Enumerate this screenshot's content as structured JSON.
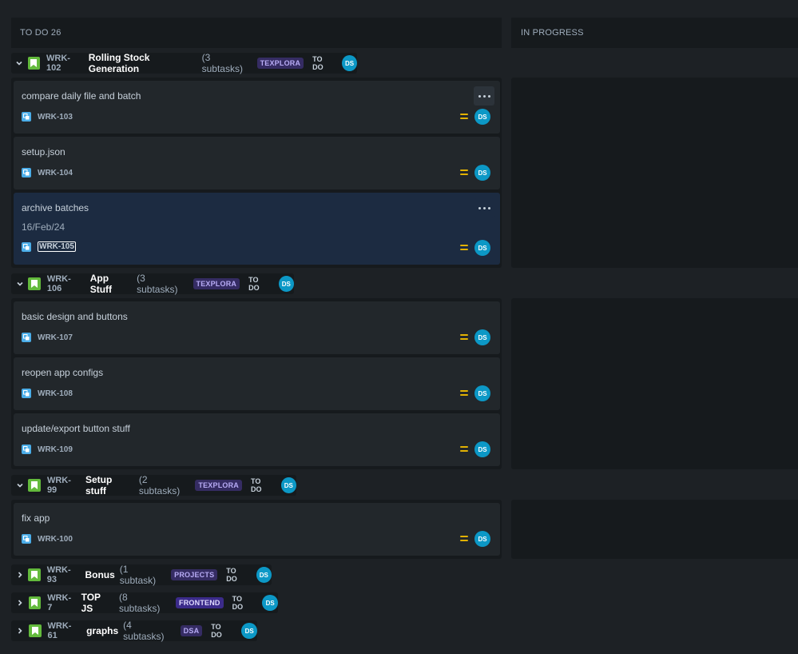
{
  "columns": [
    {
      "title": "TO DO 26"
    },
    {
      "title": "IN PROGRESS"
    }
  ],
  "colors": {
    "lozenge_bg": "#352c63",
    "lozenge_fg": "#b8acf6",
    "frontend_bg": "#3b2b8a",
    "avatar": "#0c98c6",
    "priority": "#e2b203"
  },
  "parents": [
    {
      "key": "WRK-102",
      "title": "Rolling Stock Generation",
      "subtasks": "(3 subtasks)",
      "label": "TEXPLORA",
      "status": "TO DO",
      "assignee": "DS",
      "expanded": true
    },
    {
      "key": "WRK-106",
      "title": "App Stuff",
      "subtasks": "(3 subtasks)",
      "label": "TEXPLORA",
      "status": "TO DO",
      "assignee": "DS",
      "expanded": true
    },
    {
      "key": "WRK-99",
      "title": "Setup stuff",
      "subtasks": "(2 subtasks)",
      "label": "TEXPLORA",
      "status": "TO DO",
      "assignee": "DS",
      "expanded": true
    },
    {
      "key": "WRK-93",
      "title": "Bonus",
      "subtasks": "(1 subtask)",
      "label": "PROJECTS",
      "status": "TO DO",
      "assignee": "DS",
      "expanded": false
    },
    {
      "key": "WRK-7",
      "title": "TOP JS",
      "subtasks": "(8 subtasks)",
      "label": "FRONTEND",
      "status": "TO DO",
      "assignee": "DS",
      "expanded": false
    },
    {
      "key": "WRK-61",
      "title": "graphs",
      "subtasks": "(4 subtasks)",
      "label": "DSA",
      "status": "TO DO",
      "assignee": "DS",
      "expanded": false
    }
  ],
  "cards": [
    {
      "title": "compare daily file and batch",
      "key": "WRK-103",
      "assignee": "DS"
    },
    {
      "title": "setup.json",
      "key": "WRK-104",
      "assignee": "DS"
    },
    {
      "title": "archive batches",
      "date": "16/Feb/24",
      "key": "WRK-105",
      "assignee": "DS"
    },
    {
      "title": "basic design and buttons",
      "key": "WRK-107",
      "assignee": "DS"
    },
    {
      "title": "reopen app configs",
      "key": "WRK-108",
      "assignee": "DS"
    },
    {
      "title": "update/export button stuff",
      "key": "WRK-109",
      "assignee": "DS"
    },
    {
      "title": "fix app",
      "key": "WRK-100",
      "assignee": "DS"
    }
  ]
}
